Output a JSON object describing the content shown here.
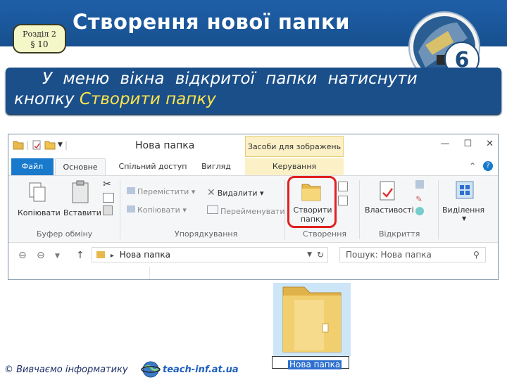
{
  "slide": {
    "badge_line1": "Розділ 2",
    "badge_line2": "§ 10",
    "title": "Створення нової папки",
    "logo_number": "6",
    "instruction_line1": "У меню вікна відкритої папки натиснути",
    "instruction_line2_plain": "кнопку ",
    "instruction_line2_highlight": "Створити папку"
  },
  "window": {
    "title": "Нова папка",
    "contextual_tab": "Засоби для зображень",
    "controls": {
      "minimize": "—",
      "maximize": "☐",
      "close": "✕"
    },
    "tabs": [
      "Файл",
      "Основне",
      "Спільний доступ",
      "Вигляд",
      "Керування"
    ],
    "ribbon": {
      "clipboard": {
        "copy": "Копіювати",
        "paste": "Вставити",
        "label": "Буфер обміну"
      },
      "organize": {
        "move_to": "Перемістити",
        "copy_to": "Копіювати",
        "delete": "Видалити",
        "rename": "Перейменувати",
        "label": "Упорядкування"
      },
      "new": {
        "new_folder_line1": "Створити",
        "new_folder_line2": "папку",
        "label": "Створення"
      },
      "open": {
        "properties": "Властивості",
        "label": "Відкриття"
      },
      "select": {
        "select": "Виділення"
      }
    },
    "address": {
      "path": "Нова папка"
    },
    "search": {
      "placeholder": "Пошук: Нова папка"
    }
  },
  "new_folder": {
    "name": "Нова папка"
  },
  "footer": {
    "left": "© Вивчаємо інформатику",
    "link": "teach-inf.at.ua"
  },
  "colors": {
    "header_blue": "#1f5fa8",
    "banner_blue": "#1b4f8a",
    "highlight_yellow": "#ffe54a",
    "file_tab_blue": "#1979ca",
    "contextual_tab_yellow": "#fbf0c6",
    "callout_red": "#e02020"
  },
  "icons": [
    "folder-icon",
    "globe-icon",
    "logo-icon",
    "clipboard-icon",
    "scissors-icon",
    "properties-icon",
    "select-icon",
    "delete-icon"
  ]
}
